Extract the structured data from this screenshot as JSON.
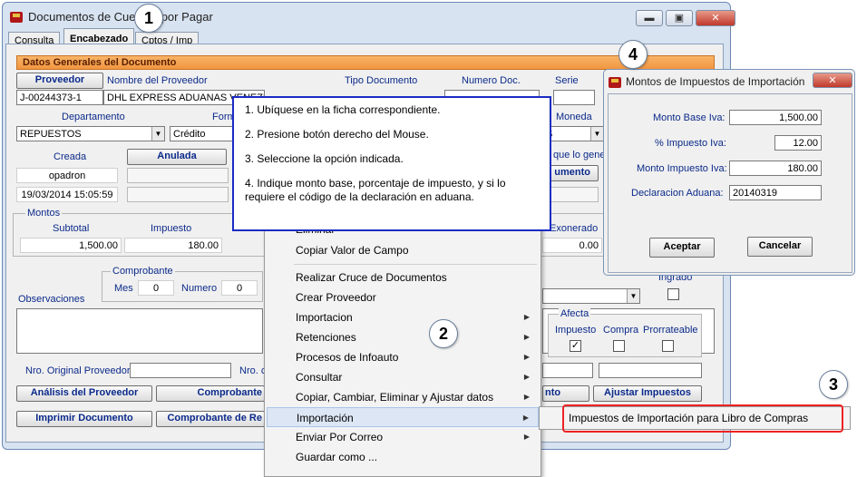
{
  "window": {
    "title": "Documentos de Cuentas por Pagar",
    "buttons": {
      "min": "▬",
      "max": "▣",
      "close": "✕"
    }
  },
  "tabs": [
    "Consulta",
    "Encabezado",
    "Cptos / Imp"
  ],
  "section_header": "Datos Generales del Documento",
  "proveedor": {
    "button": "Proveedor",
    "name_label": "Nombre del Proveedor",
    "code": "J-00244373-1",
    "name": "DHL EXPRESS ADUANAS VENEZUE"
  },
  "labels": {
    "tipo_documento": "Tipo Documento",
    "numero_doc": "Numero Doc.",
    "serie": "Serie",
    "departamento": "Departamento",
    "forma": "Form",
    "moneda": "Moneda",
    "creada": "Creada",
    "anulada": "Anulada",
    "que_lo_gen": "que lo gene",
    "umento": "umento",
    "montos": "Montos",
    "subtotal": "Subtotal",
    "impuesto": "Impuesto",
    "exonerado": "Exonerado",
    "comprobante": "Comprobante",
    "mes": "Mes",
    "numero": "Numero",
    "observaciones": "Observaciones",
    "ingrado": "Ingrado",
    "afecta": "Afecta",
    "af_impuesto": "Impuesto",
    "af_compra": "Compra",
    "af_prorrateable": "Prorrateable",
    "nro_original": "Nro. Original Proveedor",
    "nro_c": "Nro. c"
  },
  "values": {
    "departamento": "REPUESTOS",
    "forma": "Crédito",
    "moneda": "S",
    "usuario": "opadron",
    "fecha": "19/03/2014 15:05:59",
    "subtotal": "1,500.00",
    "impuesto": "180.00",
    "exonerado": "0.00",
    "mes": "0",
    "numero": "0"
  },
  "bottom_buttons": {
    "analisis": "Análisis del Proveedor",
    "comprobante": "Comprobante",
    "imprimir": "Imprimir Documento",
    "comprobante_re": "Comprobante de Re",
    "nto": "nto",
    "ajustar": "Ajustar Impuestos"
  },
  "context_menu": [
    {
      "label": "Eliminar",
      "arrow": false
    },
    {
      "label": "Copiar Valor de Campo",
      "arrow": false
    },
    {
      "label": "Realizar Cruce de Documentos",
      "arrow": false
    },
    {
      "label": "Crear Proveedor",
      "arrow": false
    },
    {
      "label": "Importacion",
      "arrow": true
    },
    {
      "label": "Retenciones",
      "arrow": true
    },
    {
      "label": "Procesos de Infoauto",
      "arrow": true
    },
    {
      "label": "Consultar",
      "arrow": true
    },
    {
      "label": "Copiar, Cambiar, Eliminar y Ajustar datos",
      "arrow": true
    },
    {
      "label": "Importación",
      "arrow": true
    },
    {
      "label": "Enviar Por Correo",
      "arrow": true
    },
    {
      "label": "Guardar como ...",
      "arrow": false
    }
  ],
  "submenu_item": "Impuestos de Importación para Libro de Compras",
  "instructions": [
    "1. Ubíquese en la ficha correspondiente.",
    "2. Presione botón derecho del Mouse.",
    "3. Seleccione la opción indicada.",
    "4. Indique monto base, porcentaje de impuesto, y si lo requiere el código de la declaración en aduana."
  ],
  "dialog": {
    "title": "Montos de Impuestos de Importación",
    "monto_base_label": "Monto Base Iva:",
    "monto_base": "1,500.00",
    "pct_label": "% Impuesto Iva:",
    "pct": "12.00",
    "monto_imp_label": "Monto Impuesto Iva:",
    "monto_imp": "180.00",
    "declaracion_label": "Declaracion Aduana:",
    "declaracion": "20140319",
    "aceptar": "Aceptar",
    "cancelar": "Cancelar",
    "close": "✕"
  },
  "callouts": [
    "1",
    "2",
    "3",
    "4"
  ]
}
